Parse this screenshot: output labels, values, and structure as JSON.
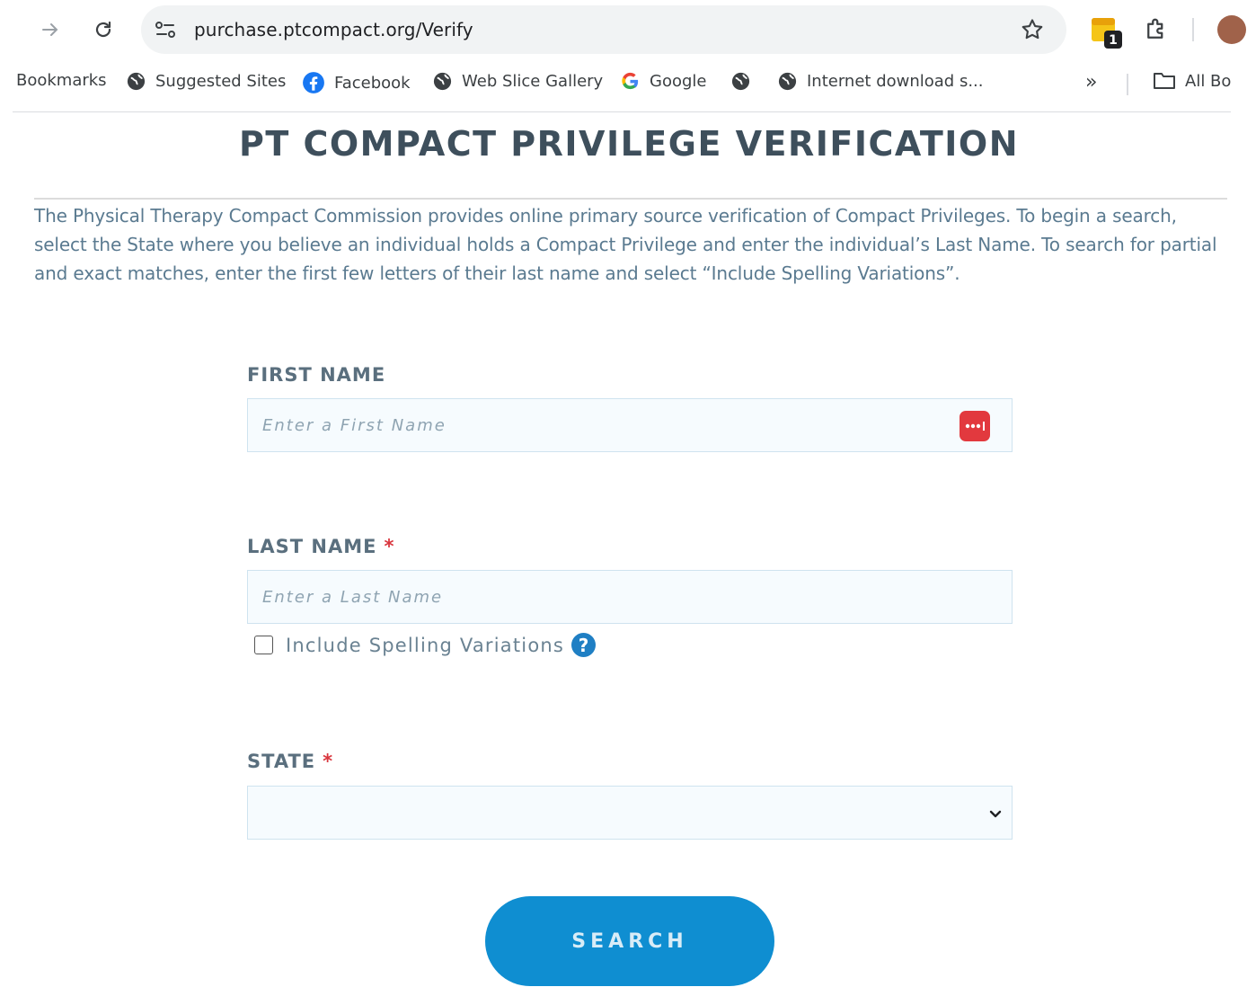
{
  "browser": {
    "url": "purchase.ptcompact.org/Verify",
    "extension_badge": "1",
    "bookmarks": [
      {
        "label": "Bookmarks",
        "icon": "none"
      },
      {
        "label": "Suggested Sites",
        "icon": "globe-icon"
      },
      {
        "label": "Facebook",
        "icon": "facebook-icon"
      },
      {
        "label": "Web Slice Gallery",
        "icon": "globe-icon"
      },
      {
        "label": "Google",
        "icon": "google-icon"
      },
      {
        "label": "",
        "icon": "globe-icon"
      },
      {
        "label": "Internet download s...",
        "icon": "globe-icon"
      }
    ],
    "overflow_label": "»",
    "all_bookmarks_label": "All Bo"
  },
  "page": {
    "title": "PT COMPACT PRIVILEGE VERIFICATION",
    "intro": "The Physical Therapy Compact Commission provides online primary source verification of Compact Privileges. To begin a search, select the State where you believe an individual holds a Compact Privilege and enter the individual’s Last Name. To search for partial and exact matches, enter the first few letters of their last name and select “Include Spelling Variations”."
  },
  "form": {
    "first_name": {
      "label": "FIRST NAME",
      "placeholder": "Enter a First Name",
      "value": ""
    },
    "last_name": {
      "label": "LAST NAME",
      "required_mark": "*",
      "placeholder": "Enter a Last Name",
      "value": ""
    },
    "spelling": {
      "label": "Include Spelling Variations",
      "checked": false,
      "help": "?"
    },
    "state": {
      "label": "STATE",
      "required_mark": "*",
      "selected": ""
    },
    "search_label": "SEARCH"
  },
  "colors": {
    "accent": "#0f8ed1",
    "title": "#3e4f5c",
    "intro_text": "#5a7a90",
    "required": "#d9363e",
    "password_icon": "#e2393e"
  }
}
